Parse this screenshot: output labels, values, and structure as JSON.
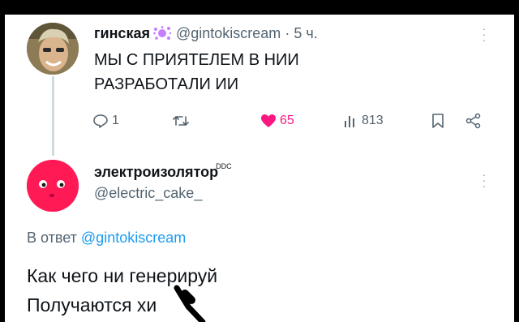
{
  "tweet": {
    "author_name": "гинская",
    "author_handle": "@gintokiscream",
    "separator": "·",
    "time": "5 ч.",
    "text_line1": "МЫ С ПРИЯТЕЛЕМ В НИИ",
    "text_line2": "РАЗРАБОТАЛИ ИИ",
    "actions": {
      "replies": "1",
      "reposts": "",
      "likes": "65",
      "views": "813"
    },
    "badge_icon": "splat-icon"
  },
  "reply": {
    "author_name": "электроизолятор",
    "author_suffix": "DDC",
    "author_handle": "@electric_cake_",
    "reply_prefix": "В ответ",
    "reply_mention": "@gintokiscream",
    "text_line1": "Как чего ни генерируй",
    "text_line2": "Получаются х",
    "text_line2_end": "и"
  },
  "colors": {
    "like": "#f91880",
    "mention": "#1d9bf0",
    "muted": "#536471",
    "text": "#0f1419",
    "avatar_reply": "#ff1a55"
  }
}
